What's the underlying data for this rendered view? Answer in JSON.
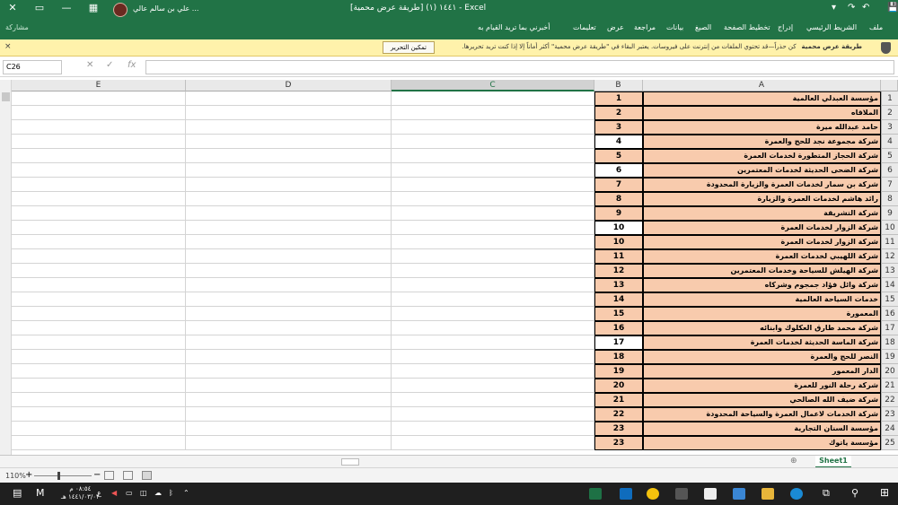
{
  "titlebar": {
    "title": "١٤٤١ (١) [طريقة عرض محمية] - Excel",
    "user": "علي بن سالم عالي ...",
    "controls": [
      "✕",
      "▭",
      "—"
    ],
    "quick_access": [
      "💾",
      "↶",
      "↷",
      "▾"
    ]
  },
  "ribbon": {
    "tabs": [
      "ملف",
      "الشريط الرئيسي",
      "إدراج",
      "تخطيط الصفحة",
      "الصيغ",
      "بيانات",
      "مراجعة",
      "عرض",
      "تعليمات",
      "أخبرني بما تريد القيام به"
    ],
    "share": "مشاركة"
  },
  "message_bar": {
    "title": "طريقة عرض محمية",
    "text": "كن حذراً—قد تحتوي الملفات من إنترنت على فيروسات. يعتبر البقاء في \"طريقة عرض محمية\" أكثر أماناً إلا إذا كنت تريد تحريرها.",
    "button": "تمكين التحرير",
    "close": "×"
  },
  "formula_bar": {
    "name_box": "C26",
    "fx": "fx",
    "cancel": "✕",
    "enter": "✓",
    "value": ""
  },
  "columns": [
    "E",
    "D",
    "C",
    "B",
    "A"
  ],
  "rows": [
    {
      "n": "1",
      "b": "1",
      "a": "مؤسسة العبدلي العالمية",
      "bw": false
    },
    {
      "n": "2",
      "b": "2",
      "a": "الملاقاه",
      "bw": false
    },
    {
      "n": "3",
      "b": "3",
      "a": "حامد عبدالله ميرة",
      "bw": false
    },
    {
      "n": "4",
      "b": "4",
      "a": "شركة مجموعة نجد للحج والعمرة",
      "bw": true
    },
    {
      "n": "5",
      "b": "5",
      "a": "شركة الحجاز المتطورة لخدمات العمرة",
      "bw": false
    },
    {
      "n": "6",
      "b": "6",
      "a": "شركة الضحى الحديثة لخدمات المعتمرين",
      "bw": true
    },
    {
      "n": "7",
      "b": "7",
      "a": "شركة بن سمار لخدمات العمرة والزيارة المحدودة",
      "bw": false
    },
    {
      "n": "8",
      "b": "8",
      "a": "رائد هاشم لخدمات العمرة والزيارة",
      "bw": false
    },
    {
      "n": "9",
      "b": "9",
      "a": "شركة التشريقة",
      "bw": false
    },
    {
      "n": "10",
      "b": "10",
      "a": "شركة الزوار لخدمات العمرة",
      "bw": true
    },
    {
      "n": "11",
      "b": "10",
      "a": "شركة الزوار لخدمات العمرة",
      "bw": false
    },
    {
      "n": "12",
      "b": "11",
      "a": "شركة اللهيبي لخدمات العمرة",
      "bw": false
    },
    {
      "n": "13",
      "b": "12",
      "a": "شركة الهيلش للسياحة وخدمات المعتمرين",
      "bw": false
    },
    {
      "n": "14",
      "b": "13",
      "a": "شركة وائل فؤاد جمجوم وشركاه",
      "bw": false
    },
    {
      "n": "15",
      "b": "14",
      "a": "خدمات السياحة العالمية",
      "bw": false
    },
    {
      "n": "16",
      "b": "15",
      "a": "المعمورة",
      "bw": false
    },
    {
      "n": "17",
      "b": "16",
      "a": "شركة محمد طارق العكلوك وابنائه",
      "bw": false
    },
    {
      "n": "18",
      "b": "17",
      "a": "شركة الماسة الحديثة لخدمات العمرة",
      "bw": true
    },
    {
      "n": "19",
      "b": "18",
      "a": "النصر للحج والعمرة",
      "bw": false
    },
    {
      "n": "20",
      "b": "19",
      "a": "الدار المعمور",
      "bw": false
    },
    {
      "n": "21",
      "b": "20",
      "a": "شركة رحلة النور للعمرة",
      "bw": false
    },
    {
      "n": "22",
      "b": "21",
      "a": "شركة ضيف الله الصالحي",
      "bw": false
    },
    {
      "n": "23",
      "b": "22",
      "a": "شركة الخدمات لاعمال العمرة والسياحة المحدودة",
      "bw": false
    },
    {
      "n": "24",
      "b": "23",
      "a": "مؤسسة السنان التجارية",
      "bw": false
    },
    {
      "n": "25",
      "b": "23",
      "a": "مؤسسة ياتوك",
      "bw": false
    }
  ],
  "sheet_tab": "Sheet1",
  "status": {
    "zoom": "110%",
    "minus": "−",
    "plus": "+"
  },
  "taskbar": {
    "time": "٠٨:٥٤ م",
    "date": "١٤٤١/٠٣/٠٢ هـ",
    "lang": "ع"
  },
  "colors": {
    "excel_green": "#217346",
    "orange_fill": "#f8cbad",
    "msg_yellow": "#fff2ab"
  }
}
